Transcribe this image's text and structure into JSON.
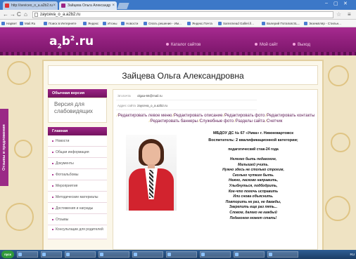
{
  "browser": {
    "tabs": [
      {
        "label": "http://seviceo_o_a.a2b2.ru",
        "active": false
      },
      {
        "label": "Зайцева Ольга Александр",
        "active": true
      }
    ],
    "window_controls": [
      "–",
      "▢",
      "✕"
    ],
    "address": "zayceva_o_a.a2b2.ru",
    "bookmarks": [
      "Нарвет",
      "Mail.Ru",
      "Поиск в Интернете",
      "Яндекс",
      "Итоны",
      "Новости",
      "Олать решение - Им...",
      "Яндекс.Почта",
      "Samsmead Galleri.ll...",
      "Валерий Потапов:SL...",
      "Экземпляр - Стильн..."
    ]
  },
  "site": {
    "logo": {
      "a": "a",
      "sub": "2",
      "b": "b",
      "sup": "2",
      "tld": ".ru"
    },
    "nav": [
      "Каталог сайтов",
      "Мой сайт",
      "Выход"
    ]
  },
  "feedback_tab": "Отзывы и предложения",
  "page": {
    "title": "Зайцева Ольга Александровна"
  },
  "sidebar": {
    "header1": "Обычная версия",
    "sub_label": "Версия для слабовидящих",
    "header2": "Главная",
    "items": [
      "Новости",
      "Общая информация",
      "Документы",
      "Фотоальбомы",
      "Мероприятия",
      "Методические материалы",
      "Достижения и награды",
      "Отзывы",
      "Консультации для родителей"
    ]
  },
  "info": {
    "email_label": "Эл.почта",
    "email_value": "olgaa-66@mail.ru",
    "site_label": "Адрес сайта",
    "site_value": "zayceva_o_a.a2b2.ru"
  },
  "edit_links": [
    "Редактировать левое меню",
    "Редактировать описание",
    "Редактировать фото",
    "Редактировать контакты",
    "Редактировать баннеры",
    "Служебные фото",
    "Разделы сайта",
    "Счетчик"
  ],
  "poem": {
    "line1": "МБДОУ ДС № 67 «Умка» г. Нижневартовск",
    "line2": "Воспитатель: 2 квалификационной категории;",
    "line3": "педагогический стаж-24 года",
    "verse": [
      "Нелегко быть педагогом,",
      "Малышей учить.",
      "Нужно здесь не столько строгим,",
      "Сколько чутким быть.",
      "Нежно, ласково направить,",
      "Улыбнуться, подбодрить,",
      "Кое-что помочь исправить",
      "Или снова объяснить.",
      "Повторить не раз, не дважды,",
      "Закрепить еще раз пять...",
      "Словом, далеко не каждый",
      "Педагогом может стать!"
    ]
  },
  "taskbar": {
    "start": "пуск",
    "buttons": [
      "",
      "",
      "",
      "",
      "",
      "",
      "",
      "",
      "",
      ""
    ],
    "tray_lang": "RU",
    "clock": ""
  },
  "colors": {
    "brand_purple": "#9b2585",
    "header_gradient_top": "#a62a8f",
    "jacket_red": "#d2232e",
    "background_cream": "#efe3c3"
  }
}
